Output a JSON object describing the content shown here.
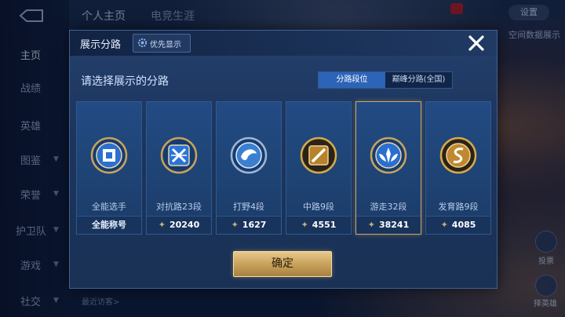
{
  "background": {
    "top_tabs": [
      "个人主页",
      "电竞生涯"
    ],
    "nav_items": [
      "主页",
      "战绩",
      "英雄",
      "图鉴",
      "荣誉",
      "护卫队",
      "游戏",
      "社交"
    ],
    "top_right_button": "设置",
    "top_right_label": "空间数据展示",
    "bottom_left_text": "最近访客>",
    "side_labels": [
      "投票",
      "择英雄"
    ]
  },
  "modal": {
    "title": "展示分路",
    "priority_button": "优先显示",
    "prompt": "请选择展示的分路",
    "mode_tabs": [
      {
        "label": "分路段位",
        "active": true
      },
      {
        "label": "巅峰分路(全国)",
        "active": false
      }
    ],
    "confirm_label": "确定"
  },
  "lanes": [
    {
      "name": "全能选手",
      "footer": "全能称号",
      "footer_is_score": false,
      "selected": false,
      "icon": "all-round-emblem-icon",
      "emblem_color": "#6fb2ff"
    },
    {
      "name": "对抗路23段",
      "footer": "20240",
      "footer_is_score": true,
      "selected": false,
      "icon": "clash-lane-emblem-icon",
      "emblem_color": "#4d9aff"
    },
    {
      "name": "打野4段",
      "footer": "1627",
      "footer_is_score": true,
      "selected": false,
      "icon": "jungle-emblem-icon",
      "emblem_color": "#9fd0ff"
    },
    {
      "name": "中路9段",
      "footer": "4551",
      "footer_is_score": true,
      "selected": false,
      "icon": "mid-lane-emblem-icon",
      "emblem_color": "#e0a640"
    },
    {
      "name": "游走32段",
      "footer": "38241",
      "footer_is_score": true,
      "selected": true,
      "icon": "roam-emblem-icon",
      "emblem_color": "#5ba8ff"
    },
    {
      "name": "发育路9段",
      "footer": "4085",
      "footer_is_score": true,
      "selected": false,
      "icon": "farm-lane-emblem-icon",
      "emblem_color": "#e0a640"
    }
  ],
  "colors": {
    "accent_gold": "#c9a866",
    "active_tab": "#2c64b8"
  }
}
